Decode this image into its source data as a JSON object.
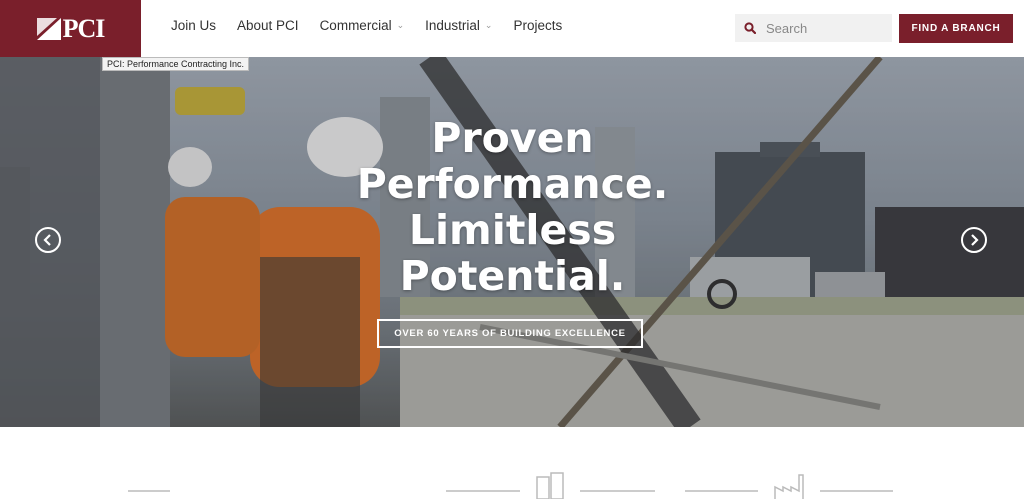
{
  "header": {
    "logo_text": "PCI",
    "tooltip": "PCI: Performance Contracting Inc.",
    "brand_color": "#7a1f2b",
    "nav": [
      {
        "label": "Join Us",
        "dropdown": false
      },
      {
        "label": "About PCI",
        "dropdown": false
      },
      {
        "label": "Commercial",
        "dropdown": true
      },
      {
        "label": "Industrial",
        "dropdown": true
      },
      {
        "label": "Projects",
        "dropdown": false
      }
    ],
    "search_placeholder": "Search",
    "find_branch_label": "FIND A BRANCH"
  },
  "hero": {
    "headline_lines": [
      "Proven",
      "Performance.",
      "Limitless",
      "Potential."
    ],
    "tagline": "OVER 60 YEARS OF BUILDING EXCELLENCE",
    "prev_icon": "chevron-left-icon",
    "next_icon": "chevron-right-icon"
  }
}
